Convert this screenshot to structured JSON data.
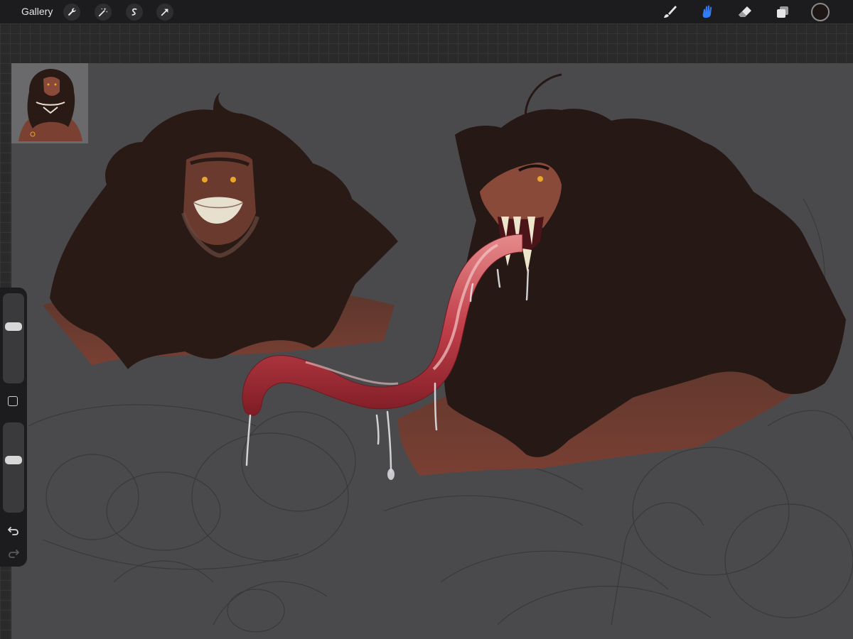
{
  "topbar": {
    "gallery_label": "Gallery",
    "actions": [
      {
        "name": "actions-wrench-icon"
      },
      {
        "name": "adjustments-wand-icon"
      },
      {
        "name": "selection-s-icon"
      },
      {
        "name": "transform-arrow-icon"
      }
    ],
    "tools": [
      {
        "name": "brush-icon",
        "active": false
      },
      {
        "name": "smudge-icon",
        "active": true
      },
      {
        "name": "eraser-icon",
        "active": false
      },
      {
        "name": "layers-icon",
        "active": false
      }
    ],
    "current_color": "#1e1614",
    "accent_color": "#2f7dfb"
  },
  "sidebar": {
    "brush_size_level": 0.65,
    "opacity_level": 0.6
  }
}
